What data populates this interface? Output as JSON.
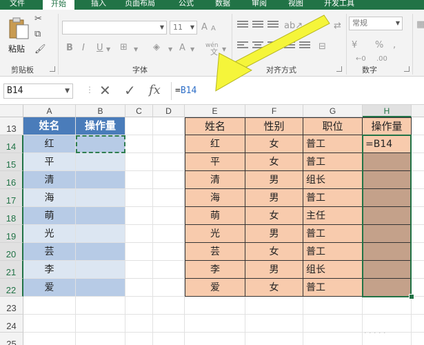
{
  "ribbon": {
    "tabs": [
      "文件",
      "开始",
      "插入",
      "页面布局",
      "公式",
      "数据",
      "审阅",
      "视图",
      "开发工具"
    ],
    "active_tab": "开始",
    "groups": {
      "clipboard": {
        "label": "剪贴板",
        "paste_label": "粘贴"
      },
      "font": {
        "label": "字体",
        "font_size": "11",
        "bold": "B",
        "italic": "I",
        "underline": "U",
        "grow": "A",
        "wen": "wén"
      },
      "alignment": {
        "label": "对齐方式"
      },
      "number": {
        "label": "数字",
        "format": "常规"
      }
    }
  },
  "formula_bar": {
    "name_box": "B14",
    "formula_prefix": "=",
    "formula_ref": "B14",
    "cancel_icon": "✕",
    "enter_icon": "✓",
    "fx_icon": "fx"
  },
  "sheet": {
    "columns": [
      "A",
      "B",
      "C",
      "D",
      "E",
      "F",
      "G",
      "H"
    ],
    "rows": [
      "13",
      "14",
      "15",
      "16",
      "17",
      "18",
      "19",
      "20",
      "21",
      "22",
      "23",
      "24",
      "25"
    ],
    "left_table": {
      "headers": [
        "姓名",
        "操作量"
      ],
      "names": [
        "红",
        "平",
        "清",
        "海",
        "萌",
        "光",
        "芸",
        "李",
        "爱"
      ]
    },
    "right_table": {
      "headers": [
        "姓名",
        "性别",
        "职位",
        "操作量"
      ],
      "rows": [
        [
          "红",
          "女",
          "普工",
          "=B14"
        ],
        [
          "平",
          "女",
          "普工",
          ""
        ],
        [
          "清",
          "男",
          "组长",
          ""
        ],
        [
          "海",
          "男",
          "普工",
          ""
        ],
        [
          "萌",
          "女",
          "主任",
          ""
        ],
        [
          "光",
          "男",
          "普工",
          ""
        ],
        [
          "芸",
          "女",
          "普工",
          ""
        ],
        [
          "李",
          "男",
          "组长",
          ""
        ],
        [
          "爱",
          "女",
          "普工",
          ""
        ]
      ]
    }
  },
  "colors": {
    "accent": "#217346",
    "header_blue": "#4a7cba",
    "peach": "#f8cbad",
    "brown": "#c4a18a",
    "arrow": "#f5f53a"
  }
}
